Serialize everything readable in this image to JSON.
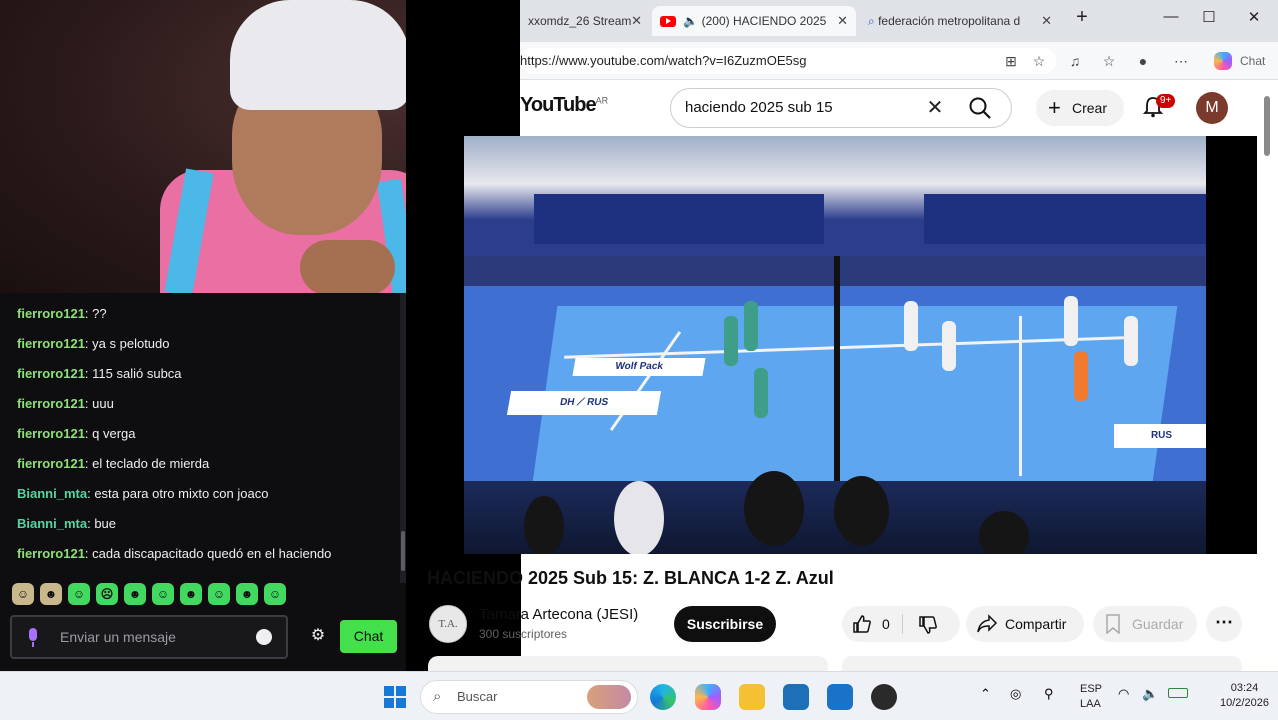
{
  "chat": {
    "messages": [
      {
        "user": "fierroro121",
        "text": "??",
        "color": "#8ee07a"
      },
      {
        "user": "fierroro121",
        "text": "ya s pelotudo",
        "color": "#8ee07a"
      },
      {
        "user": "fierroro121",
        "text": "115 salió subca",
        "color": "#8ee07a"
      },
      {
        "user": "fierroro121",
        "text": "uuu",
        "color": "#8ee07a"
      },
      {
        "user": "fierroro121",
        "text": "q verga",
        "color": "#8ee07a"
      },
      {
        "user": "fierroro121",
        "text": "el teclado de mierda",
        "color": "#8ee07a"
      },
      {
        "user": "Bianni_mta",
        "text": "esta para otro mixto con joaco",
        "color": "#56d4a0"
      },
      {
        "user": "Bianni_mta",
        "text": "bue",
        "color": "#56d4a0"
      },
      {
        "user": "fierroro121",
        "text": "cada discapacitado quedó en el haciendo",
        "color": "#8ee07a"
      }
    ],
    "input_placeholder": "Enviar un mensaje",
    "chat_button": "Chat"
  },
  "browser": {
    "tabs": [
      {
        "label": "xxomdz_26 Stream"
      },
      {
        "label": "(200) HACIENDO 2025"
      },
      {
        "label": "federación metropolitana d"
      }
    ],
    "url": "https://www.youtube.com/watch?v=I6ZuzmOE5sg",
    "copilot_label": "Chat"
  },
  "youtube": {
    "logo": "YouTube",
    "region": "AR",
    "search_query": "haciendo 2025 sub 15",
    "create_label": "Crear",
    "notif_badge": "9+",
    "avatar_letter": "M"
  },
  "video": {
    "title": "HACIENDO 2025 Sub 15: Z. BLANCA 1-2 Z. Azul",
    "channel_name": "Tamara Artecona (JESI)",
    "channel_initials": "T.A.",
    "subscribers": "300 suscriptores",
    "subscribe_label": "Suscribirse",
    "likes": "0",
    "share_label": "Compartir",
    "save_label": "Guardar"
  },
  "taskbar": {
    "search_placeholder": "Buscar",
    "lang": "ESP",
    "layout": "LAA",
    "time": "03:24",
    "date": "10/2/2026"
  }
}
